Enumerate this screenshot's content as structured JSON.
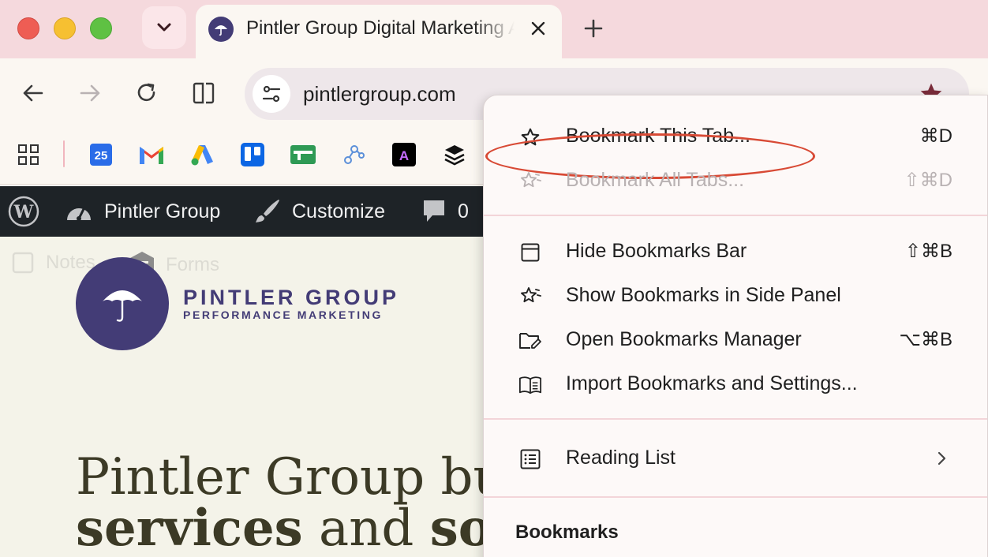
{
  "browser": {
    "tab": {
      "title": "Pintler Group Digital Marketing Agency"
    },
    "url": "pintlergroup.com",
    "bookmarks_bar": {
      "items": [
        {
          "name": "apps-grid-icon"
        },
        {
          "name": "google-calendar-icon",
          "text": "25"
        },
        {
          "name": "gmail-icon",
          "text": "M"
        },
        {
          "name": "google-ads-icon"
        },
        {
          "name": "trello-icon"
        },
        {
          "name": "sheet-icon"
        },
        {
          "name": "network-nodes-icon"
        },
        {
          "name": "adobe-express-icon",
          "text": "A"
        },
        {
          "name": "layers-stack-icon"
        }
      ]
    }
  },
  "wp_admin_bar": {
    "site_name": "Pintler Group",
    "customize": "Customize",
    "comments_count": "0"
  },
  "page": {
    "ghost_left": "Notes",
    "ghost_right": "Forms",
    "logo_name": "PINTLER GROUP",
    "logo_tagline": "PERFORMANCE MARKETING",
    "hero_line1": "Pintler Group bui",
    "hero_line2_bold1": "services",
    "hero_line2_mid": " and ",
    "hero_line2_bold2": "soft"
  },
  "bookmarks_menu": {
    "items": [
      {
        "label": "Bookmark This Tab...",
        "shortcut": "⌘D",
        "icon": "star-outline-icon",
        "enabled": true,
        "highlighted": true
      },
      {
        "label": "Bookmark All Tabs...",
        "shortcut": "⇧⌘D",
        "icon": "stars-icon",
        "enabled": false
      },
      {
        "label": "Hide Bookmarks Bar",
        "shortcut": "⇧⌘B",
        "icon": "window-bar-icon",
        "enabled": true
      },
      {
        "label": "Show Bookmarks in Side Panel",
        "shortcut": "",
        "icon": "stars-panel-icon",
        "enabled": true
      },
      {
        "label": "Open Bookmarks Manager",
        "shortcut": "⌥⌘B",
        "icon": "folder-edit-icon",
        "enabled": true
      },
      {
        "label": "Import Bookmarks and Settings...",
        "shortcut": "",
        "icon": "book-open-icon",
        "enabled": true
      },
      {
        "label": "Reading List",
        "shortcut": "",
        "icon": "list-icon",
        "enabled": true,
        "submenu": true
      }
    ],
    "section_heading": "Bookmarks"
  },
  "colors": {
    "tabstrip": "#f5d9dd",
    "toolbar": "#fbf7f2",
    "wp_bar": "#1e2327",
    "brand_purple": "#433c76",
    "highlight_ring": "#d84a35"
  }
}
